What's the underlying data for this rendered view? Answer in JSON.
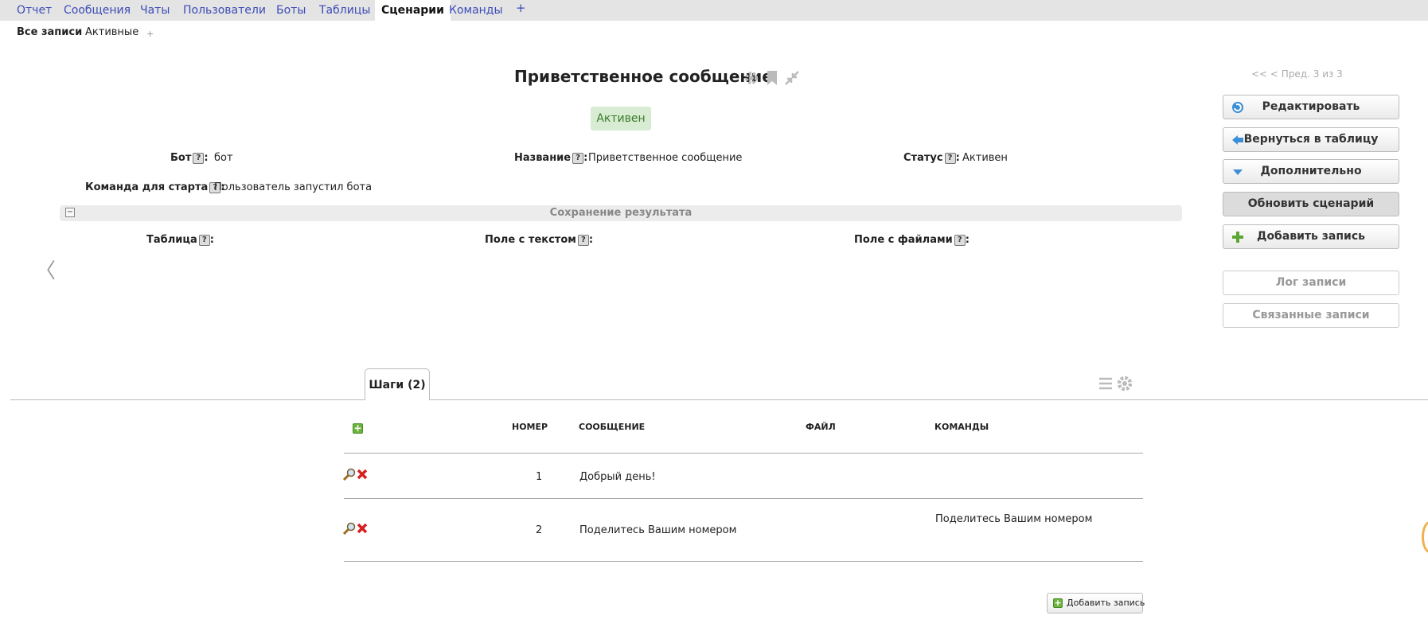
{
  "topnav": {
    "tabs": [
      "Отчет",
      "Сообщения",
      "Чаты",
      "Пользователи",
      "Боты",
      "Таблицы",
      "Сценарии",
      "Команды"
    ],
    "active": "Сценарии",
    "add": "+"
  },
  "subnav": {
    "all": "Все записи",
    "active": "Активные",
    "add": "+"
  },
  "record": {
    "title": "Приветственное сообщение",
    "status_badge": "Активен",
    "fields": {
      "bot_label": "Бот",
      "bot_value": "бот",
      "name_label": "Название",
      "name_value": "Приветственное сообщение",
      "status_label": "Статус",
      "status_value": "Активен",
      "start_label": "Команда для старта",
      "start_value": "Пользователь запустил бота"
    },
    "section_title": "Сохранение результата",
    "section_fields": {
      "table_label": "Таблица",
      "text_field_label": "Поле с текстом",
      "files_field_label": "Поле с файлами"
    },
    "help_mark": "?",
    "colon": ":",
    "collapse": "−"
  },
  "sidebar": {
    "pager": "<< < Пред. 3 из 3",
    "buttons": {
      "edit": "Редактировать",
      "back": "Вернуться в таблицу",
      "more": "Дополнительно",
      "refresh": "Обновить сценарий",
      "add": "Добавить запись",
      "log": "Лог записи",
      "related": "Связанные записи"
    }
  },
  "left_nav": "〈",
  "steps": {
    "tab_label": "Шаги (2)",
    "columns": {
      "number": "НОМЕР",
      "message": "СООБЩЕНИЕ",
      "file": "ФАЙЛ",
      "commands": "КОМАНДЫ"
    },
    "rows": [
      {
        "number": "1",
        "message": "Добрый день!",
        "file": "",
        "commands": ""
      },
      {
        "number": "2",
        "message": "Поделитесь Вашим номером",
        "file": "",
        "commands": "Поделитесь Вашим номером"
      }
    ],
    "add_button": "Добавить запись",
    "add_plus": "+"
  },
  "colors": {
    "link": "#3b4bb7",
    "status_bg": "#d8ecd3",
    "status_fg": "#3b7a2a",
    "add_green": "#6cb33f"
  }
}
